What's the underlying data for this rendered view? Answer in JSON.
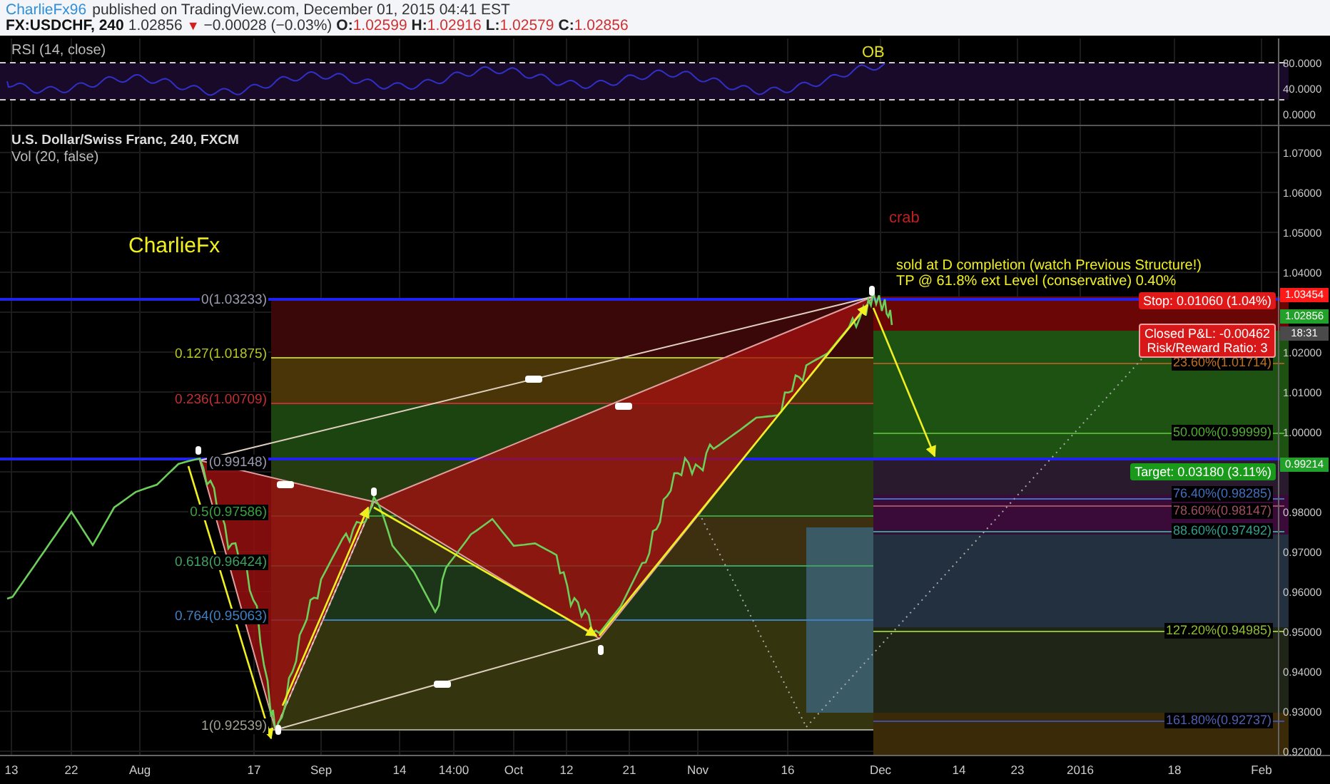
{
  "header": {
    "author": "CharlieFx96",
    "published": "published on TradingView.com, December 01, 2015 04:41 EST",
    "symbol": "FX:USDCHF, 240",
    "last": "1.02856",
    "direction_icon": "▼",
    "change": "−0.00028 (−0.03%)",
    "ohlc": [
      {
        "label": "O:",
        "value": "1.02599"
      },
      {
        "label": "H:",
        "value": "1.02916"
      },
      {
        "label": "L:",
        "value": "1.02579"
      },
      {
        "label": "C:",
        "value": "1.02856"
      }
    ]
  },
  "rsi_pane": {
    "title": "RSI (14, close)",
    "note": "OB",
    "axis": [
      "80.0000",
      "40.0000",
      "0.0000"
    ]
  },
  "main_pane": {
    "title": "U.S. Dollar/Swiss Franc, 240, FXCM",
    "indicator": "Vol (20, false)",
    "annotations": [
      {
        "kind": "brand",
        "text": "CharlieFx"
      },
      {
        "kind": "pattern",
        "text": "crab"
      },
      {
        "kind": "note",
        "text": "sold at D completion (watch Previous Structure!)"
      },
      {
        "kind": "note",
        "text": "TP @ 61.8% ext Level (conservative) 0.40%"
      }
    ],
    "fib_left": [
      "0(1.03233)",
      "0.127(1.01875)",
      "0.236(1.00709)",
      "(0.99148)",
      "0.5(0.97586)",
      "0.618(0.96424)",
      "0.764(0.95063)",
      "1(0.92539)"
    ],
    "fib_right": [
      "23.60%(1.01714)",
      "50.00%(0.99999)",
      "76.40%(0.98285)",
      "78.60%(0.98147)",
      "88.60%(0.97492)",
      "127.20%(0.94985)",
      "161.80%(0.92737)"
    ],
    "position": {
      "stop": "Stop: 0.01060 (1.04%)",
      "pnl": "Closed P&L: -0.00462",
      "ratio": "Risk/Reward Ratio: 3",
      "target": "Target: 0.03180 (3.11%)"
    }
  },
  "price_axis": {
    "ticks": [
      "1.07000",
      "1.06000",
      "1.05000",
      "1.04000",
      "1.02000",
      "1.01000",
      "1.00000",
      "0.98000",
      "0.97000",
      "0.96000",
      "0.95000",
      "0.94000",
      "0.93000",
      "0.92000"
    ],
    "tags": [
      {
        "text": "1.03454",
        "color": "#ff1a1a"
      },
      {
        "text": "1.02856",
        "color": "#22a02a"
      },
      {
        "text": "18:31",
        "color": "#4a4a4a"
      },
      {
        "text": "0.99214",
        "color": "#22a02a"
      }
    ]
  },
  "time_axis": [
    "13",
    "22",
    "Aug",
    "17",
    "Sep",
    "14",
    "14:00",
    "Oct",
    "12",
    "21",
    "Nov",
    "16",
    "Dec",
    "14",
    "23",
    "2016",
    "18",
    "Feb"
  ]
}
